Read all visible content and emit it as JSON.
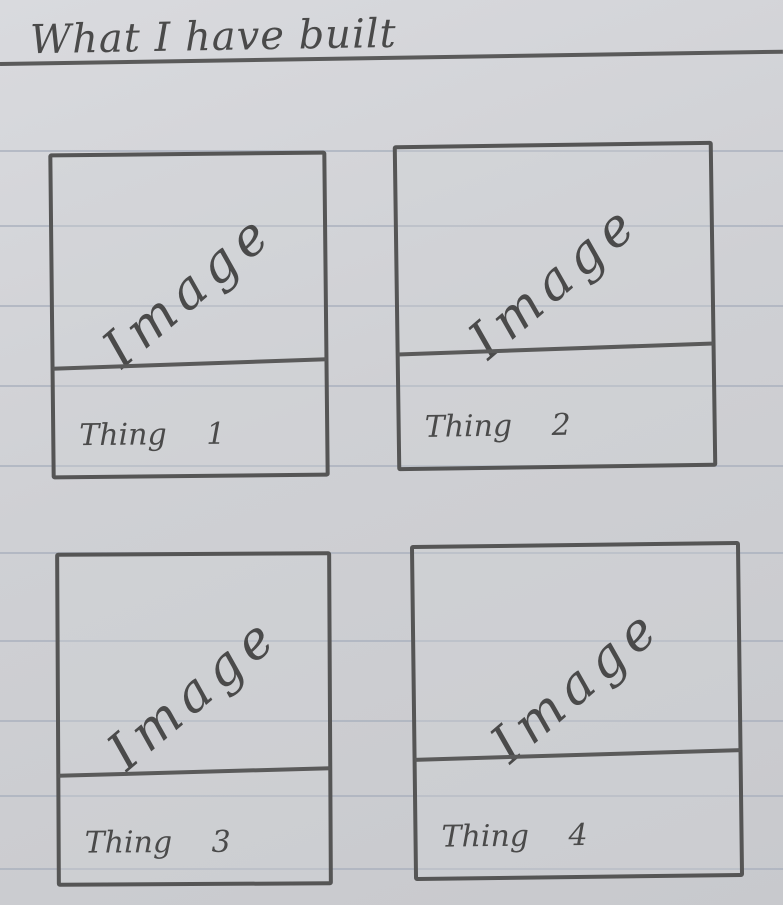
{
  "header": {
    "title": "What I have built"
  },
  "cards": [
    {
      "image_label": "Image",
      "title": "Thing 1"
    },
    {
      "image_label": "Image",
      "title": "Thing 2"
    },
    {
      "image_label": "Image",
      "title": "Thing 3"
    },
    {
      "image_label": "Image",
      "title": "Thing 4"
    }
  ]
}
